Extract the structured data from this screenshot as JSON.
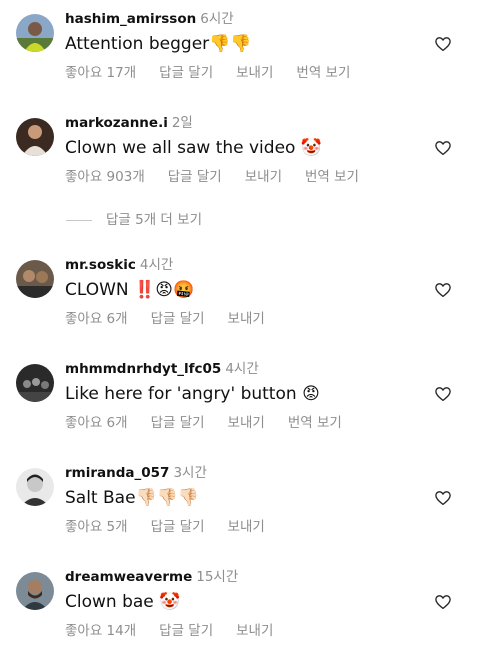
{
  "comments": [
    {
      "username": "hashim_amirsson",
      "time": "6시간",
      "text": "Attention begger",
      "emoji": "👎👎",
      "likes": "좋아요 17개",
      "reply": "답글 달기",
      "send": "보내기",
      "translate": "번역 보기"
    },
    {
      "username": "markozanne.i",
      "time": "2일",
      "text": "Clown we all saw the video",
      "emoji": "🤡",
      "likes": "좋아요 903개",
      "reply": "답글 달기",
      "send": "보내기",
      "translate": "번역 보기"
    },
    {
      "username": "mr.soskic",
      "time": "4시간",
      "text": "CLOWN",
      "emoji": "‼️😡🤬",
      "likes": "좋아요 6개",
      "reply": "답글 달기",
      "send": "보내기",
      "translate": ""
    },
    {
      "username": "mhmmdnrhdyt_lfc05",
      "time": "4시간",
      "text": "Like here for 'angry' button",
      "emoji": "😡",
      "likes": "좋아요 6개",
      "reply": "답글 달기",
      "send": "보내기",
      "translate": "번역 보기"
    },
    {
      "username": "rmiranda_057",
      "time": "3시간",
      "text": "Salt Bae",
      "emoji": "👎🏻👎🏻👎🏻",
      "likes": "좋아요 5개",
      "reply": "답글 달기",
      "send": "보내기",
      "translate": ""
    },
    {
      "username": "dreamweaverme",
      "time": "15시간",
      "text": "Clown bae",
      "emoji": "🤡",
      "likes": "좋아요 14개",
      "reply": "답글 달기",
      "send": "보내기",
      "translate": ""
    }
  ],
  "more_replies": "답글 5개 더 보기",
  "icons": {
    "like": "heart-outline-icon"
  },
  "colors": {
    "text": "#111111",
    "secondary": "#8e8e8e"
  }
}
